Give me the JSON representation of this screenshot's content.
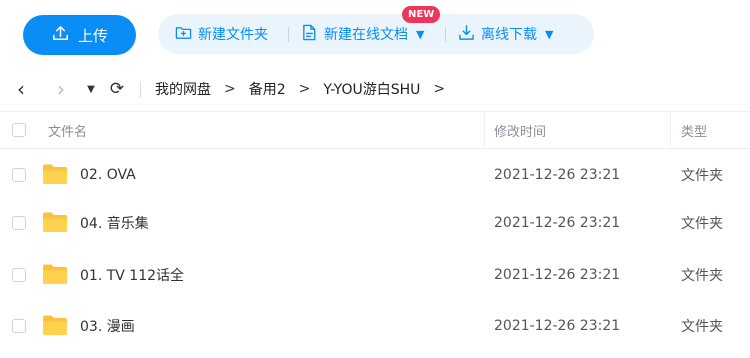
{
  "toolbar": {
    "upload_label": "上传",
    "new_folder_label": "新建文件夹",
    "online_doc_label": "新建在线文档",
    "online_doc_badge": "NEW",
    "offline_download_label": "离线下载",
    "accent_color": "#0a8df5",
    "badge_color": "#f0355b"
  },
  "nav": {
    "back_icon": "chevron-left",
    "forward_icon": "chevron-right",
    "history_icon": "triangle-down",
    "refresh_icon": "refresh",
    "breadcrumbs": [
      "我的网盘",
      "备用2",
      "Y-YOU游白SHU"
    ],
    "separator": ">"
  },
  "table": {
    "columns": {
      "name": "文件名",
      "modified": "修改时间",
      "type": "类型"
    },
    "rows": [
      {
        "name": "02. OVA",
        "modified": "2021-12-26 23:21",
        "type": "文件夹",
        "icon": "folder"
      },
      {
        "name": "04. 音乐集",
        "modified": "2021-12-26 23:21",
        "type": "文件夹",
        "icon": "folder"
      },
      {
        "name": "01. TV 112话全",
        "modified": "2021-12-26 23:21",
        "type": "文件夹",
        "icon": "folder"
      },
      {
        "name": "03. 漫画",
        "modified": "2021-12-26 23:21",
        "type": "文件夹",
        "icon": "folder"
      }
    ]
  }
}
